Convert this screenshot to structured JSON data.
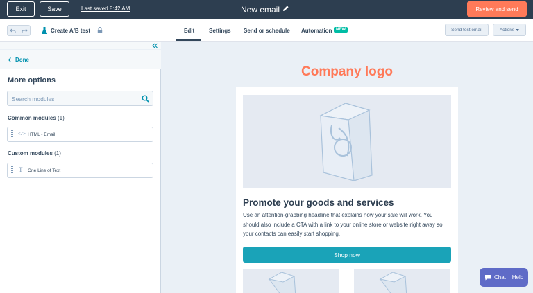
{
  "topbar": {
    "exit_label": "Exit",
    "save_label": "Save",
    "last_saved": "Last saved 8:42 AM",
    "email_title": "New email",
    "review_label": "Review and send"
  },
  "subbar": {
    "ab_test_label": "Create A/B test",
    "tabs": [
      {
        "label": "Edit",
        "active": true
      },
      {
        "label": "Settings",
        "active": false
      },
      {
        "label": "Send or schedule",
        "active": false
      },
      {
        "label": "Automation",
        "active": false,
        "badge": "NEW"
      }
    ],
    "send_test_label": "Send test email",
    "actions_label": "Actions"
  },
  "left_panel": {
    "done_label": "Done",
    "title": "More options",
    "search_placeholder": "Search modules",
    "common_section": {
      "label": "Common modules",
      "count": "(1)"
    },
    "common_modules": [
      {
        "icon": "</>",
        "name": "HTML - Email"
      }
    ],
    "custom_section": {
      "label": "Custom modules",
      "count": "(1)"
    },
    "custom_modules": [
      {
        "icon": "T",
        "name": "One Line of Text"
      }
    ]
  },
  "email": {
    "logo_text": "Company logo",
    "headline": "Promote your goods and services",
    "body_lines": [
      "Use an attention-grabbing headline that explains how your sale will work. You",
      "should also include a CTA with a link to your online store or website right away so",
      "your contacts can easily start shopping."
    ],
    "cta_label": "Shop now"
  },
  "chat": {
    "chat_label": "Chat",
    "help_label": "Help"
  },
  "colors": {
    "topbar": "#2d3e50",
    "primary_cta": "#ff7a59",
    "logo": "#ff7a59",
    "shop_button": "#1aa3b8",
    "link": "#0091ae",
    "chat": "#5f6bc7",
    "new_badge": "#00bda5"
  }
}
